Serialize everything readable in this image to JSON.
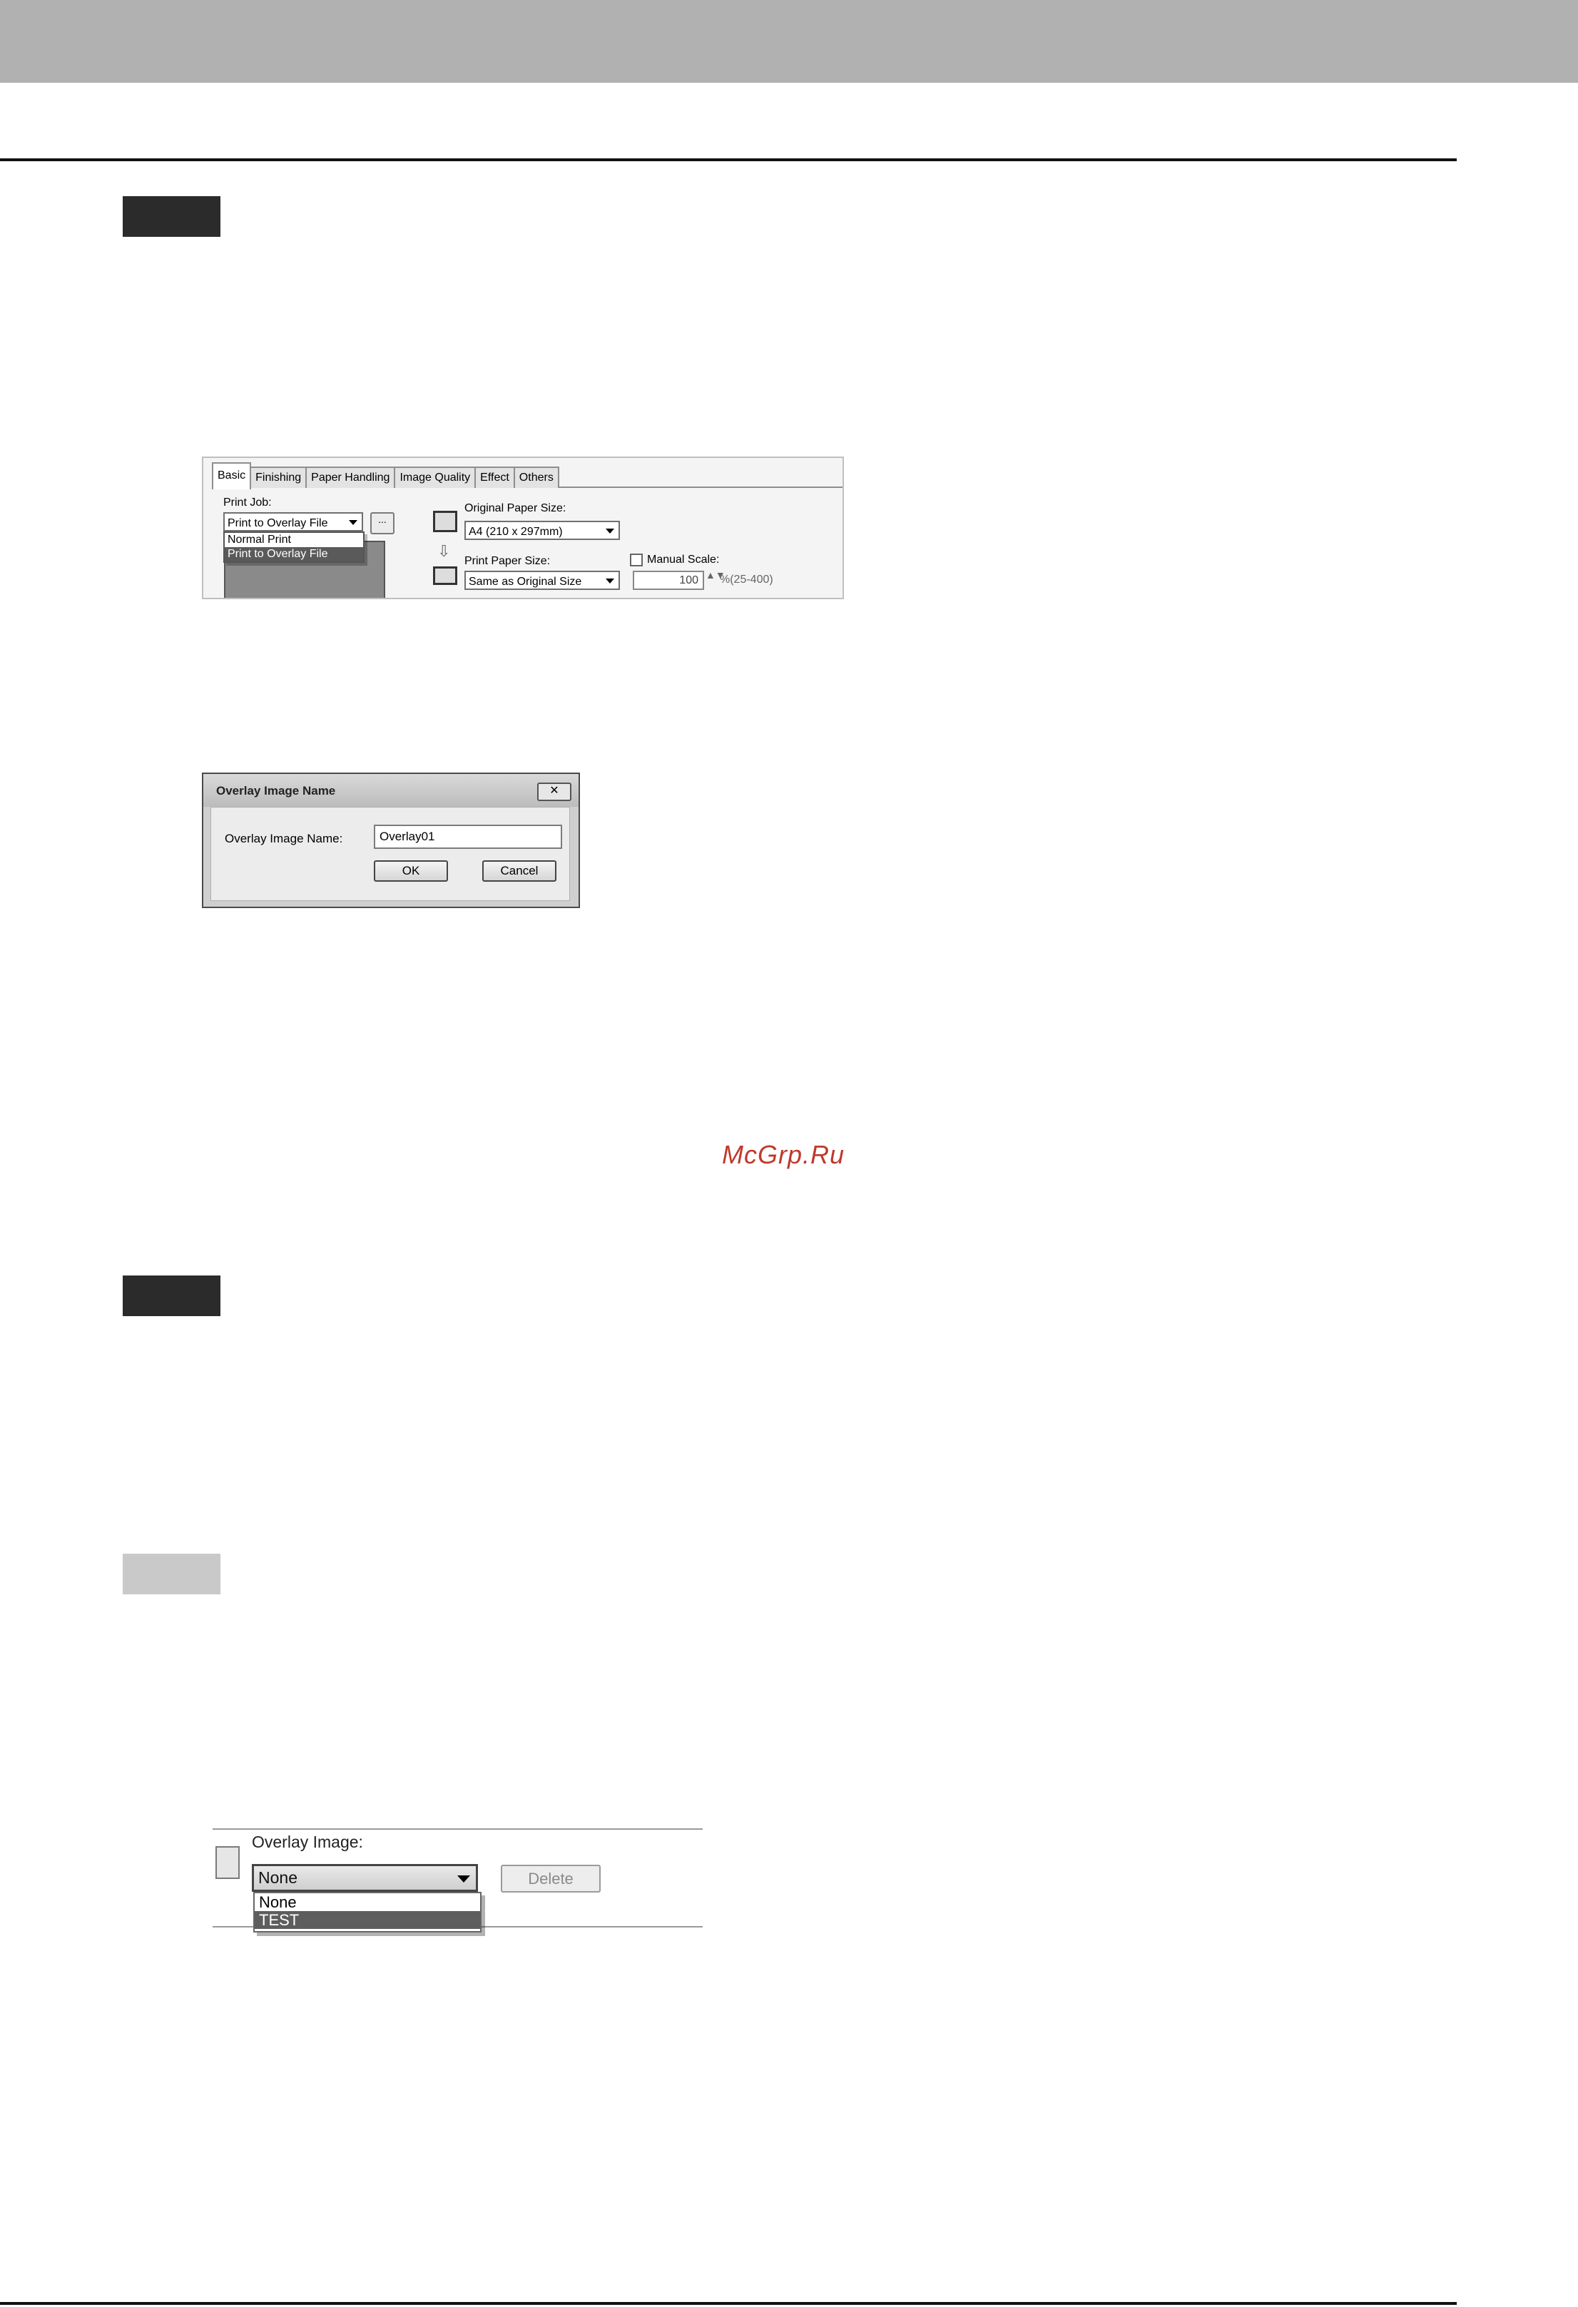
{
  "shot1": {
    "tabs": [
      "Basic",
      "Finishing",
      "Paper Handling",
      "Image Quality",
      "Effect",
      "Others"
    ],
    "print_job_label": "Print Job:",
    "print_job_value": "Print to Overlay File",
    "print_job_options": [
      "Normal Print",
      "Print to Overlay File"
    ],
    "browse_button": "...",
    "original_paper_size_label": "Original Paper Size:",
    "original_paper_size_value": "A4 (210 x 297mm)",
    "print_paper_size_label": "Print Paper Size:",
    "print_paper_size_value": "Same as Original Size",
    "manual_scale_label": "Manual Scale:",
    "scale_value": "100",
    "scale_range": "%(25-400)"
  },
  "dialog": {
    "title": "Overlay Image Name",
    "close": "✕",
    "field_label": "Overlay Image Name:",
    "field_value": "Overlay01",
    "ok": "OK",
    "cancel": "Cancel"
  },
  "shot3": {
    "label": "Overlay Image:",
    "value": "None",
    "options": [
      "None",
      "TEST"
    ],
    "delete_button": "Delete"
  },
  "watermark": "McGrp.Ru"
}
